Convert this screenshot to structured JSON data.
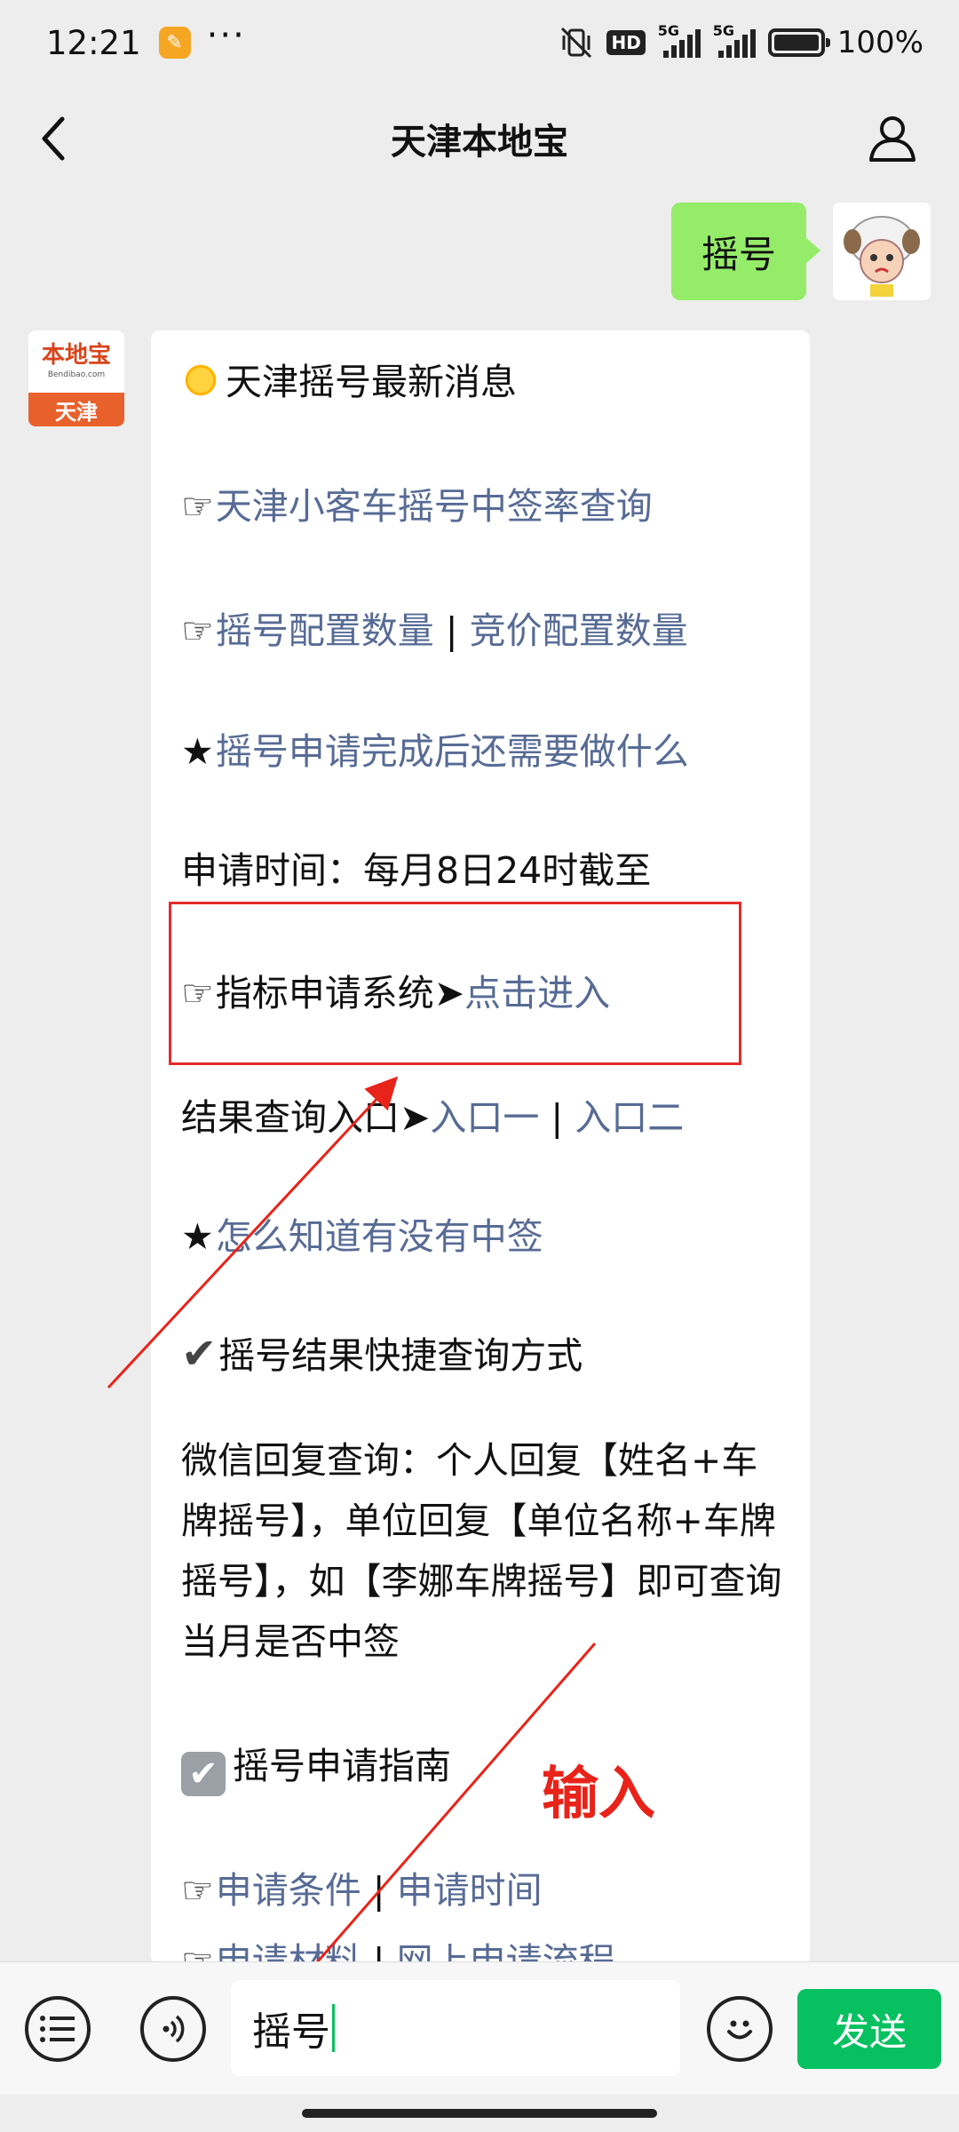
{
  "status_bar": {
    "time": "12:21",
    "dots": "···",
    "hd_label": "HD",
    "signal1": "5G",
    "signal2": "5G",
    "battery_pct": "100%"
  },
  "header": {
    "title": "天津本地宝"
  },
  "outgoing": {
    "text": "摇号"
  },
  "bot": {
    "avatar_logo": "本地宝",
    "avatar_url": "Bendibao.com",
    "avatar_city": "天津"
  },
  "message": {
    "title": "天津摇号最新消息",
    "link_rate": "天津小客车摇号中签率查询",
    "link_lottery_count": "摇号配置数量",
    "sep1": " | ",
    "link_bid_count": "竞价配置数量",
    "link_after_apply": "摇号申请完成后还需要做什么",
    "apply_time": "申请时间：每月8日24时截至",
    "system_label": "指标申请系统",
    "system_arrow": "➤",
    "link_enter": "点击进入",
    "result_label": "结果查询入口",
    "result_arrow": "➤",
    "link_entry1": "入口一",
    "sep2": " | ",
    "link_entry2": "入口二",
    "link_how_know": "怎么知道有没有中签",
    "quick_query": "摇号结果快捷查询方式",
    "wechat_reply": "微信回复查询：个人回复【姓名+车牌摇号】，单位回复【单位名称+车牌摇号】，如【李娜车牌摇号】即可查询当月是否中签",
    "guide_title": "摇号申请指南",
    "link_conditions": "申请条件",
    "sep3": " | ",
    "link_time": "申请时间",
    "link_materials": "申请材料",
    "sep4": " | ",
    "link_process": "网上申请流程"
  },
  "annotation": {
    "text": "输入",
    "color": "#e8231a"
  },
  "input_bar": {
    "value": "摇号",
    "send_label": "发送"
  },
  "colors": {
    "bubble_out": "#95ec69",
    "link": "#576b95",
    "send": "#07c160",
    "highlight": "#e52a2a"
  }
}
